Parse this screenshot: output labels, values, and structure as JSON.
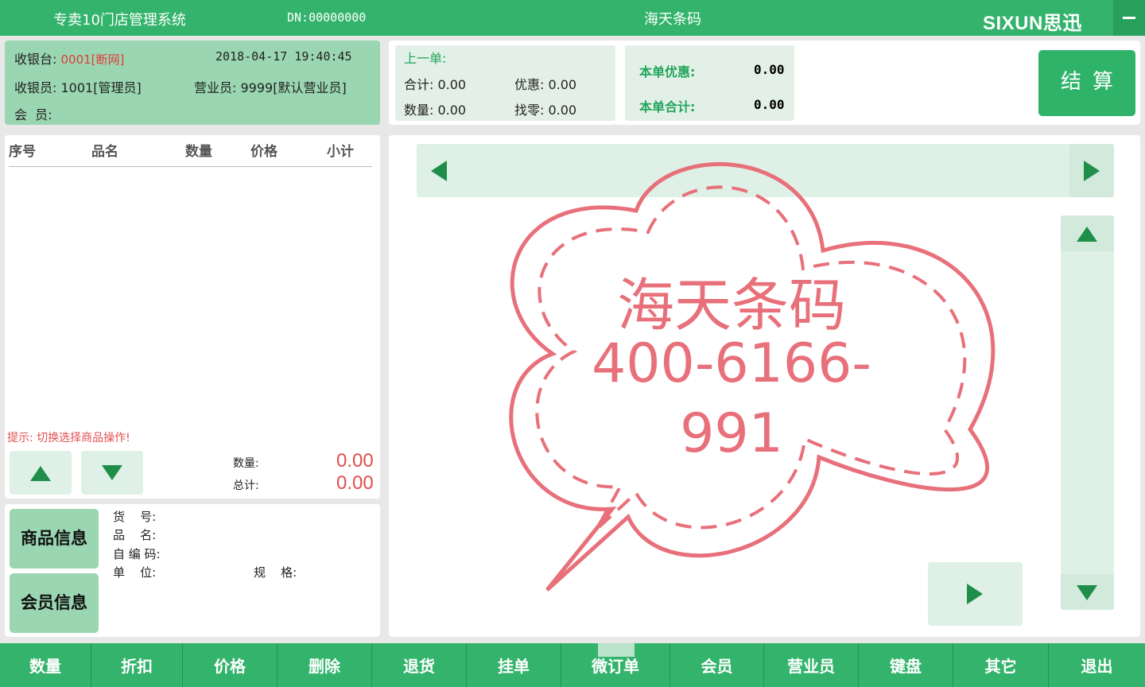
{
  "titlebar": {
    "app_title": "专卖10门店管理系统",
    "dn": "DN:00000000",
    "center_title": "海天条码",
    "brand": "SIXUN思迅"
  },
  "info": {
    "register_label": "收银台:",
    "register_value": "0001[断网]",
    "datetime": "2018-04-17 19:40:45",
    "cashier": "收银员: 1001[管理员]",
    "salesperson": "营业员: 9999[默认营业员]",
    "member": "会  员:"
  },
  "last_order": {
    "title": "上一单:",
    "total": "合计: 0.00",
    "discount": "优惠: 0.00",
    "quantity": "数量: 0.00",
    "change": "找零: 0.00"
  },
  "current_order": {
    "discount_label": "本单优惠:",
    "discount_value": "0.00",
    "total_label": "本单合计:",
    "total_value": "0.00"
  },
  "checkout_label": "结算",
  "order_list": {
    "columns": [
      "序号",
      "品名",
      "数量",
      "价格",
      "小计"
    ],
    "hint": "提示: 切换选择商品操作!",
    "qty_label": "数量:",
    "qty_value": "0.00",
    "total_label": "总计:",
    "total_value": "0.00"
  },
  "product": {
    "tab_product": "商品信息",
    "tab_member": "会员信息",
    "sku_label": "货    号:",
    "name_label": "品    名:",
    "code_label": "自 编 码:",
    "unit_label": "单    位:",
    "spec_label": "规    格:"
  },
  "watermark": {
    "line1": "海天条码",
    "line2": "400-6166-",
    "line3": "991",
    "color": "#e8707a"
  },
  "toolbar": [
    "数量",
    "折扣",
    "价格",
    "删除",
    "退货",
    "挂单",
    "微订单",
    "会员",
    "营业员",
    "键盘",
    "其它",
    "退出"
  ],
  "colors": {
    "primary": "#33b36b",
    "panel_green": "#9ad6b1",
    "light_green": "#dff0e6",
    "alert_red": "#e24c4c"
  }
}
